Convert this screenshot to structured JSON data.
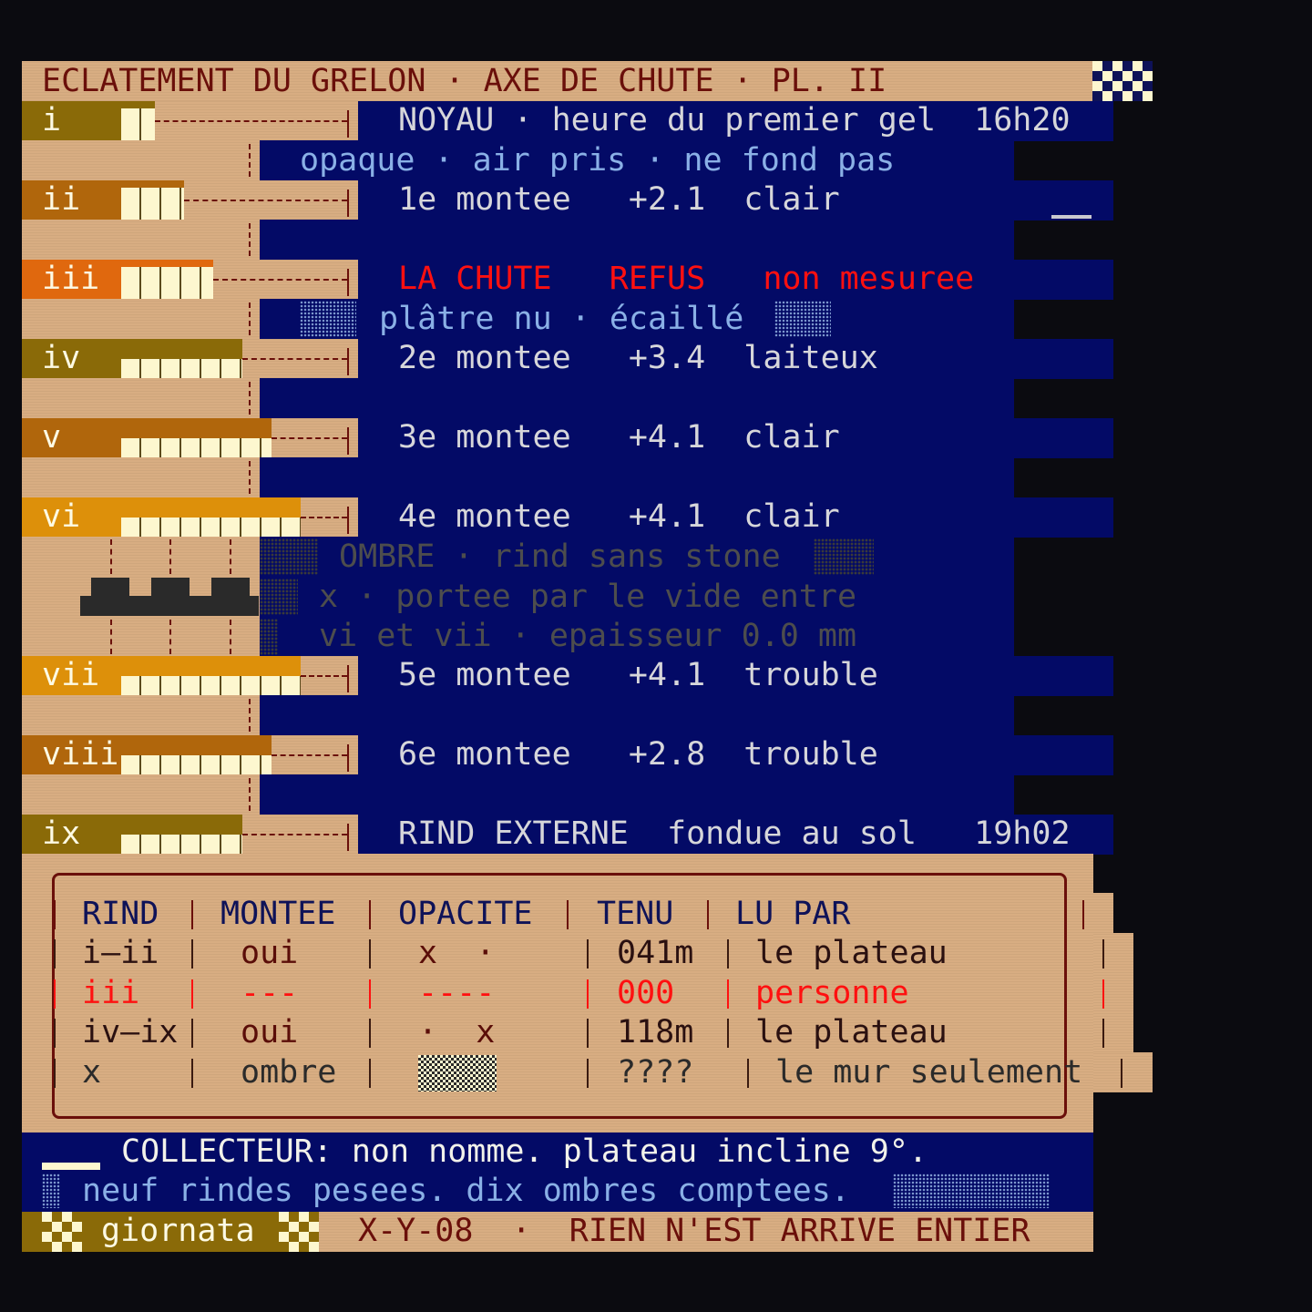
{
  "header": {
    "title": "ECLATEMENT DU GRELON · AXE DE CHUTE · PL. II"
  },
  "layers": [
    {
      "id": "i",
      "text": "NOYAU · heure du premier gel  16h20",
      "color": "#8a6a08",
      "fill": 0.12
    },
    {
      "id": "ii",
      "text": "1e montee   +2.1  clair",
      "color": "#b0660c",
      "fill": 0.22
    },
    {
      "id": "iii",
      "text": "LA CHUTE   REFUS   non mesuree",
      "color": "#e0680e",
      "fill": 0.32,
      "alert": true
    },
    {
      "id": "iv",
      "text": "2e montee   +3.4  laiteux",
      "color": "#8a6a08",
      "fill": 0.42
    },
    {
      "id": "v",
      "text": "3e montee   +4.1  clair",
      "color": "#b0660c",
      "fill": 0.52
    },
    {
      "id": "vi",
      "text": "4e montee   +4.1  clair",
      "color": "#dd900a",
      "fill": 0.62
    },
    {
      "id": "vii",
      "text": "5e montee   +4.1  trouble",
      "color": "#dd900a",
      "fill": 0.62
    },
    {
      "id": "viii",
      "text": "6e montee   +2.8  trouble",
      "color": "#b0660c",
      "fill": 0.52
    },
    {
      "id": "ix",
      "text": "RIND EXTERNE  fondue au sol   19h02",
      "color": "#8a6a08",
      "fill": 0.42
    }
  ],
  "sublines": {
    "after_i": "opaque · air pris · ne fond pas",
    "after_iii": "plâtre nu · écaillé"
  },
  "shadow": {
    "line1": "OMBRE · rind sans stone",
    "line2": "x · portee par le vide entre",
    "line3": "vi et vii · epaisseur 0.0 mm"
  },
  "table": {
    "headers": [
      "RIND",
      "MONTEE",
      "OPACITE",
      "TENU",
      "LU PAR"
    ],
    "rows": [
      {
        "rind": "i—ii",
        "montee": "oui",
        "opacite": "x  ·",
        "tenu": "041m",
        "lu": "le plateau"
      },
      {
        "rind": "iii",
        "montee": "---",
        "opacite": "----",
        "tenu": "000",
        "lu": "personne"
      },
      {
        "rind": "iv—ix",
        "montee": "oui",
        "opacite": "·  x",
        "tenu": "118m",
        "lu": "le plateau"
      },
      {
        "rind": "x",
        "montee": "ombre",
        "opacite": "",
        "tenu": "????",
        "lu": "le mur seulement"
      }
    ]
  },
  "footer": {
    "line1": "COLLECTEUR: non nomme. plateau incline 9°.",
    "line2": "neuf rindes pesees. dix ombres comptees.",
    "tag": "giornata",
    "code": "X-Y-08  ·  RIEN N'EST ARRIVE ENTIER"
  }
}
